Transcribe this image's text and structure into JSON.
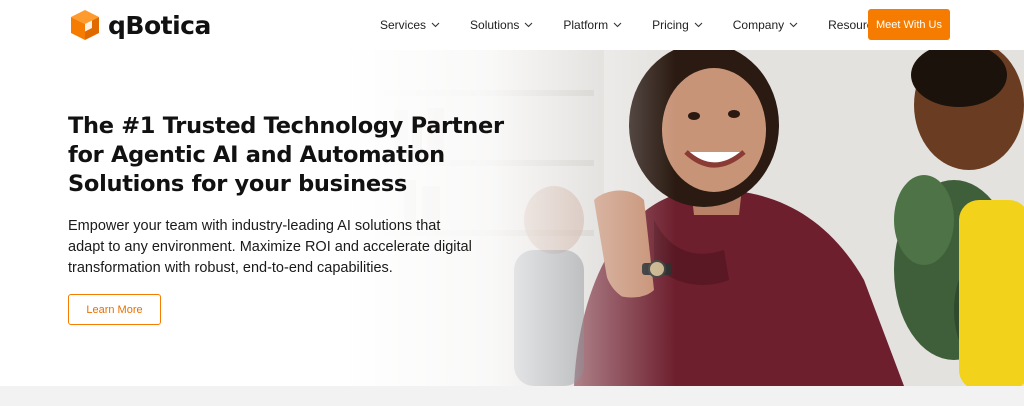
{
  "brand": {
    "name": "qBotica",
    "accent_color": "#f57c00",
    "logo_icon": "orange-cube-icon"
  },
  "nav": {
    "items": [
      {
        "label": "Services"
      },
      {
        "label": "Solutions"
      },
      {
        "label": "Platform"
      },
      {
        "label": "Pricing"
      },
      {
        "label": "Company"
      },
      {
        "label": "Resources"
      }
    ],
    "dropdown_icon": "chevron-down-icon",
    "cta_label": "Meet With Us"
  },
  "hero": {
    "title_lines": [
      "The #1 Trusted Technology Partner",
      "for Agentic AI and Automation",
      "Solutions for your business"
    ],
    "subtitle_lines": [
      "Empower your team with industry-leading AI solutions that",
      "adapt to any environment. Maximize ROI and accelerate digital",
      "transformation with robust, end-to-end capabilities."
    ],
    "button_label": "Learn More"
  }
}
